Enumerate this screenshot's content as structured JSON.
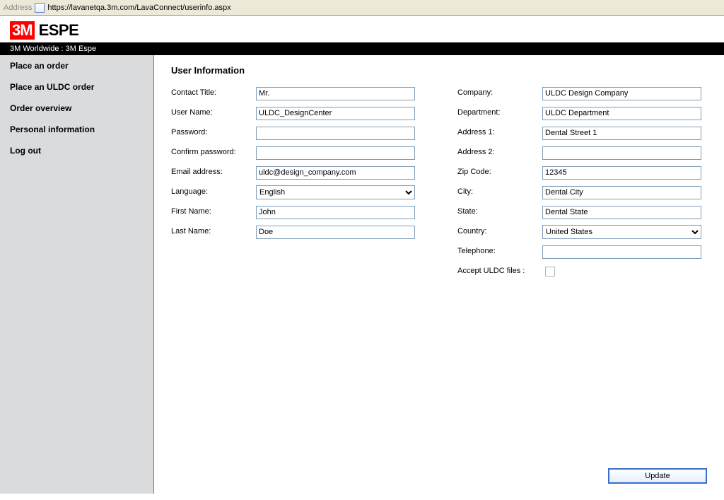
{
  "addressbar": {
    "label": "Address",
    "url": "https://lavanetqa.3m.com/LavaConnect/userinfo.aspx"
  },
  "logo": {
    "three_m": "3M",
    "espe": "ESPE"
  },
  "worldwide_bar": "3M Worldwide : 3M Espe",
  "sidebar": {
    "items": [
      {
        "label": "Place an order"
      },
      {
        "label": "Place an ULDC order"
      },
      {
        "label": "Order overview"
      },
      {
        "label": "Personal information"
      },
      {
        "label": "Log out"
      }
    ]
  },
  "page_title": "User Information",
  "left_labels": {
    "contact_title": "Contact Title:",
    "user_name": "User Name:",
    "password": "Password:",
    "confirm_password": "Confirm password:",
    "email": "Email address:",
    "language": "Language:",
    "first_name": "First Name:",
    "last_name": "Last Name:"
  },
  "left_values": {
    "contact_title": "Mr.",
    "user_name": "ULDC_DesignCenter",
    "password": "",
    "confirm_password": "",
    "email": "uldc@design_company.com",
    "language": "English",
    "first_name": "John",
    "last_name": "Doe"
  },
  "right_labels": {
    "company": "Company:",
    "department": "Department:",
    "address1": "Address 1:",
    "address2": "Address 2:",
    "zip": "Zip Code:",
    "city": "City:",
    "state": "State:",
    "country": "Country:",
    "telephone": "Telephone:",
    "accept_uldc": "Accept ULDC files :"
  },
  "right_values": {
    "company": "ULDC Design Company",
    "department": "ULDC Department",
    "address1": "Dental Street 1",
    "address2": "",
    "zip": "12345",
    "city": "Dental City",
    "state": "Dental State",
    "country": "United States",
    "telephone": "",
    "accept_uldc": false
  },
  "buttons": {
    "update": "Update"
  }
}
